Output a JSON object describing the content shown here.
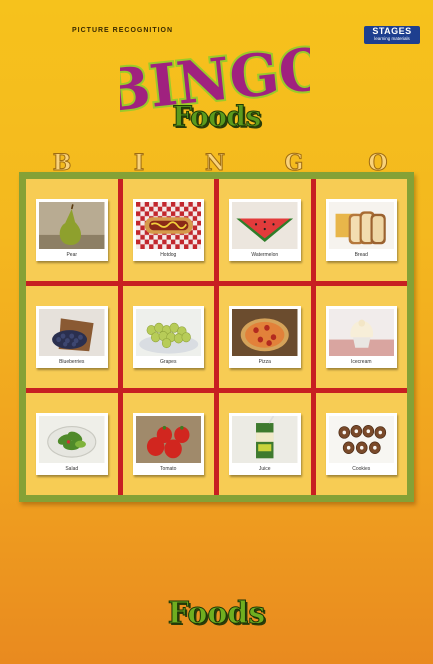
{
  "header": {
    "eyebrow": "PICTURE RECOGNITION",
    "brand": {
      "name": "STAGES",
      "tagline": "learning materials"
    },
    "logo_text": "BINGO",
    "subtitle": "Foods"
  },
  "column_letters": [
    "B",
    "I",
    "N",
    "G",
    "O"
  ],
  "board": {
    "cards": [
      {
        "label": "Pear",
        "icon": "pear-icon"
      },
      {
        "label": "Hotdog",
        "icon": "hotdog-icon"
      },
      {
        "label": "Watermelon",
        "icon": "watermelon-icon"
      },
      {
        "label": "Bread",
        "icon": "bread-icon"
      },
      {
        "label": "Blueberries",
        "icon": "blueberries-icon"
      },
      {
        "label": "Grapes",
        "icon": "grapes-icon"
      },
      {
        "label": "Pizza",
        "icon": "pizza-icon"
      },
      {
        "label": "Icecream",
        "icon": "icecream-icon"
      },
      {
        "label": "Salad",
        "icon": "salad-icon"
      },
      {
        "label": "Tomato",
        "icon": "tomato-icon"
      },
      {
        "label": "Juice",
        "icon": "juice-icon"
      },
      {
        "label": "Cookies",
        "icon": "cookies-icon"
      }
    ]
  },
  "footer": {
    "title": "Foods"
  },
  "colors": {
    "background_top": "#f6c21c",
    "background_bottom": "#e98a1f",
    "board_border": "#85a136",
    "grid_lines": "#c71f22",
    "cell": "#f7cc54",
    "logo_fill": "#a0217f",
    "logo_outline": "#9acb2a"
  }
}
